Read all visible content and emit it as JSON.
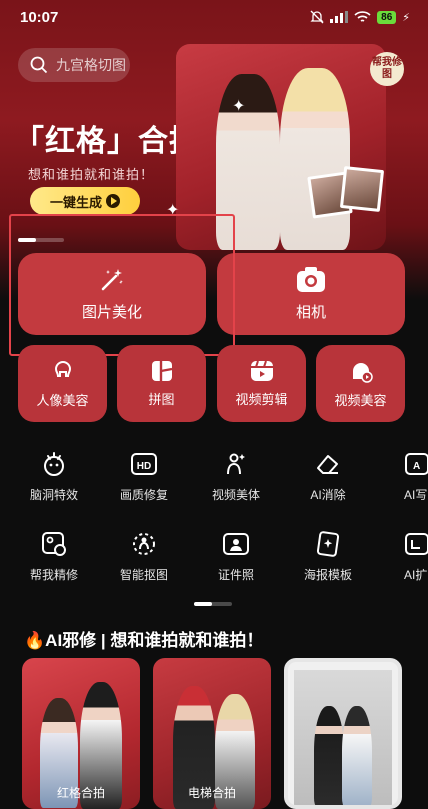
{
  "status_bar": {
    "time": "10:07",
    "battery": "86"
  },
  "search": {
    "placeholder": "九宫格切图"
  },
  "banner": {
    "title": "「红格」合拍",
    "subtitle": "想和谁拍就和谁拍！",
    "cta_label": "一键生成",
    "badge": "帮我修图"
  },
  "primary_tools": [
    {
      "label": "图片美化",
      "icon": "magic-wand-icon"
    },
    {
      "label": "相机",
      "icon": "camera-icon"
    }
  ],
  "secondary_tools": [
    {
      "label": "人像美容",
      "icon": "portrait-icon"
    },
    {
      "label": "拼图",
      "icon": "collage-icon"
    },
    {
      "label": "视频剪辑",
      "icon": "video-edit-icon"
    },
    {
      "label": "视频美容",
      "icon": "video-beauty-icon"
    }
  ],
  "tools_row1": [
    {
      "label": "脑洞特效",
      "icon": "brain-effect-icon"
    },
    {
      "label": "画质修复",
      "icon": "hd-icon"
    },
    {
      "label": "视频美体",
      "icon": "body-shape-icon"
    },
    {
      "label": "AI消除",
      "icon": "eraser-icon"
    },
    {
      "label": "AI写",
      "icon": "ai-write-icon"
    }
  ],
  "tools_row2": [
    {
      "label": "帮我精修",
      "icon": "retouch-icon"
    },
    {
      "label": "智能抠图",
      "icon": "cutout-icon"
    },
    {
      "label": "证件照",
      "icon": "id-photo-icon"
    },
    {
      "label": "海报模板",
      "icon": "poster-icon"
    },
    {
      "label": "AI扩",
      "icon": "ai-expand-icon"
    }
  ],
  "section": {
    "title": "🔥AI邪修 | 想和谁拍就和谁拍！"
  },
  "cards": [
    {
      "label": "红格合拍"
    },
    {
      "label": "电梯合拍"
    },
    {
      "label": ""
    }
  ],
  "colors": {
    "accent": "#c33a3f",
    "highlight": "#e3434a",
    "cta": "#ffd84a"
  }
}
